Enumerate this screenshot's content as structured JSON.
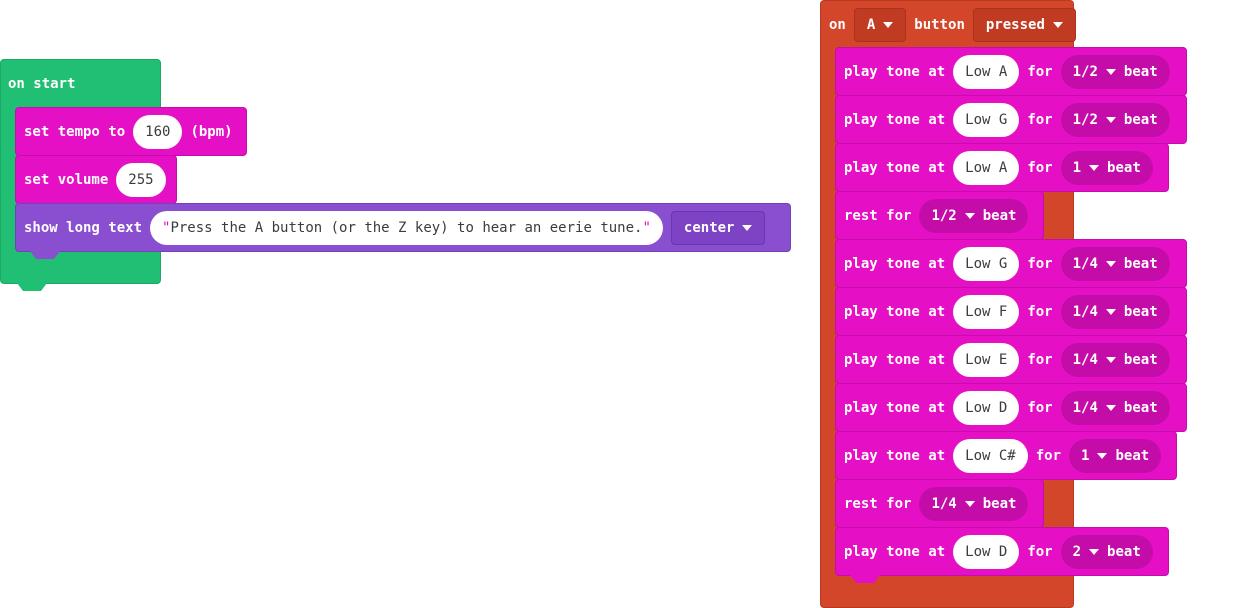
{
  "on_start": {
    "label": "on start",
    "set_tempo": {
      "label": "set tempo to",
      "value": "160",
      "unit": "(bpm)"
    },
    "set_volume": {
      "label": "set volume",
      "value": "255"
    },
    "show_long_text": {
      "label": "show long text",
      "text": "Press the A button (or the Z key) to hear an eerie tune.",
      "quote": "\"",
      "alignment": "center"
    }
  },
  "on_button": {
    "prefix": "on",
    "button": "A",
    "middle": "button",
    "event": "pressed",
    "blocks": [
      {
        "kind": "tone",
        "label": "play tone at",
        "note": "Low A",
        "for": "for",
        "beat": "1/2",
        "unit": "beat"
      },
      {
        "kind": "tone",
        "label": "play tone at",
        "note": "Low G",
        "for": "for",
        "beat": "1/2",
        "unit": "beat"
      },
      {
        "kind": "tone",
        "label": "play tone at",
        "note": "Low A",
        "for": "for",
        "beat": "1",
        "unit": "beat"
      },
      {
        "kind": "rest",
        "label": "rest for",
        "beat": "1/2",
        "unit": "beat"
      },
      {
        "kind": "tone",
        "label": "play tone at",
        "note": "Low G",
        "for": "for",
        "beat": "1/4",
        "unit": "beat"
      },
      {
        "kind": "tone",
        "label": "play tone at",
        "note": "Low F",
        "for": "for",
        "beat": "1/4",
        "unit": "beat"
      },
      {
        "kind": "tone",
        "label": "play tone at",
        "note": "Low E",
        "for": "for",
        "beat": "1/4",
        "unit": "beat"
      },
      {
        "kind": "tone",
        "label": "play tone at",
        "note": "Low D",
        "for": "for",
        "beat": "1/4",
        "unit": "beat"
      },
      {
        "kind": "tone",
        "label": "play tone at",
        "note": "Low C#",
        "for": "for",
        "beat": "1",
        "unit": "beat"
      },
      {
        "kind": "rest",
        "label": "rest for",
        "beat": "1/4",
        "unit": "beat"
      },
      {
        "kind": "tone",
        "label": "play tone at",
        "note": "Low D",
        "for": "for",
        "beat": "2",
        "unit": "beat"
      }
    ]
  },
  "colors": {
    "events": "#21bf73",
    "music": "#e510c5",
    "basic": "#8a4ed1",
    "input": "#d4462a"
  },
  "icons": {
    "dropdown": "caret-down-icon"
  }
}
